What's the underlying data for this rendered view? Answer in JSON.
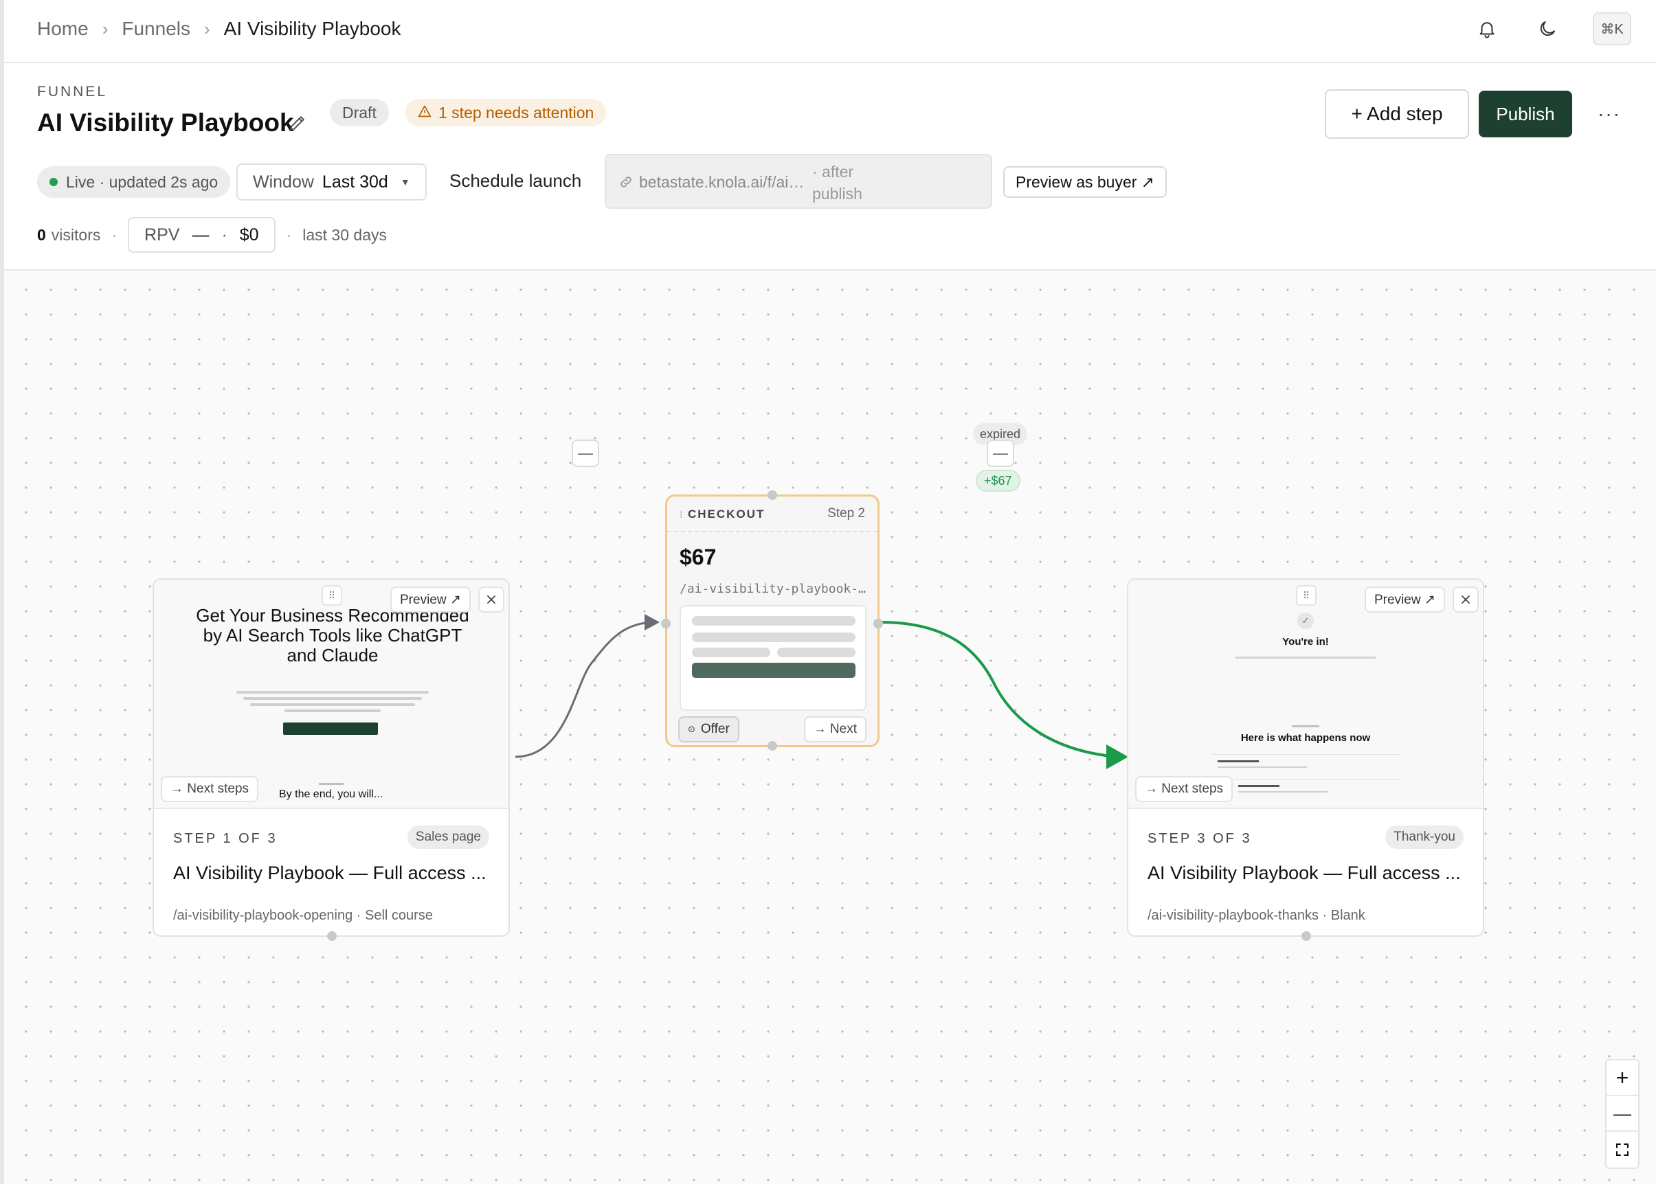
{
  "breadcrumb": [
    "Home",
    "Funnels",
    "AI Visibility Playbook"
  ],
  "topbar": {
    "shortcut": "⌘K"
  },
  "header": {
    "eyebrow": "FUNNEL",
    "title": "AI Visibility Playbook",
    "draft_label": "Draft",
    "attention_label": "1 step needs attention",
    "add_step_label": "+ Add step",
    "publish_label": "Publish",
    "more_label": "···",
    "live_status": "Live · updated 2s ago",
    "window_label": "Window",
    "window_value": "Last 30d",
    "schedule_label": "Schedule launch",
    "url": "betastate.knola.ai/f/ai-visibility-playbook",
    "url_note": "· after publish",
    "preview_buyer_label": "Preview as buyer ↗"
  },
  "stats": {
    "visitors_count": "0",
    "visitors_label": "visitors",
    "rpv_label": "RPV",
    "rpv_value": "—",
    "revenue_value": "$0",
    "period": "last 30 days"
  },
  "steps": [
    {
      "step_label": "STEP 1 OF 3",
      "type": "Sales page",
      "title": "AI Visibility Playbook — Full access ...",
      "slug": "/ai-visibility-playbook-opening · Sell course",
      "preview_label": "Preview ↗",
      "next_steps_label": "→ Next steps",
      "thumb_heading": "Get Your Business Recommended by AI Search Tools like ChatGPT and Claude",
      "thumb_footer": "By the end, you will..."
    },
    {
      "label": "CHECKOUT",
      "step_tag": "Step 2",
      "price": "$67",
      "slug": "/ai-visibility-playbook-checkout",
      "offer_label": "Offer",
      "next_label": "→ Next"
    },
    {
      "step_label": "STEP 3 OF 3",
      "type": "Thank-you",
      "title": "AI Visibility Playbook — Full access ...",
      "slug": "/ai-visibility-playbook-thanks · Blank",
      "preview_label": "Preview ↗",
      "next_steps_label": "→ Next steps",
      "thumb_title": "You're in!",
      "thumb_heading": "Here is what happens now"
    }
  ],
  "edges": {
    "minus_label": "—",
    "expired_label": "expired",
    "revenue_label": "+$67"
  },
  "zoom": {
    "in": "+",
    "out": "—"
  },
  "colors": {
    "accent": "#1e4030",
    "warning": "#b25d00",
    "success": "#1a9a4a",
    "checkout_border": "#f2c98a"
  }
}
